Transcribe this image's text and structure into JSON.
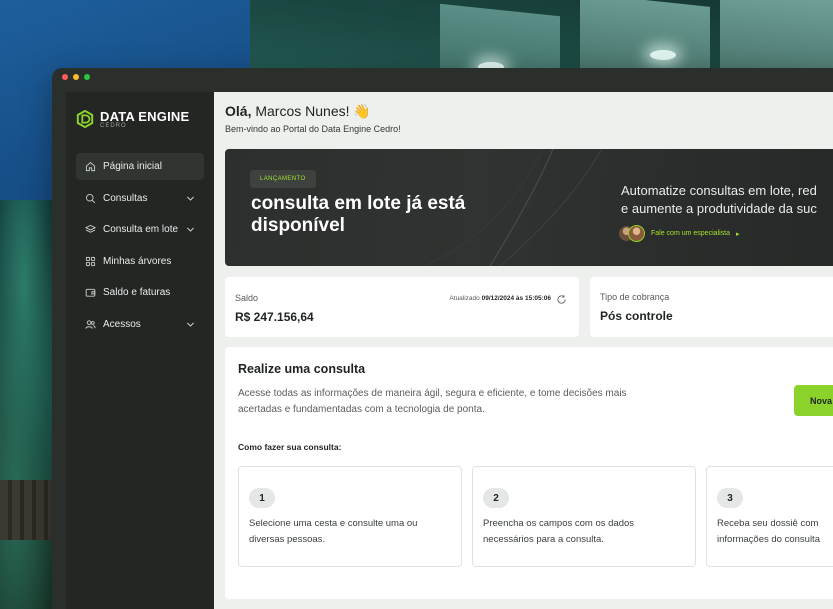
{
  "colors": {
    "accent": "#8bd32a",
    "accent_text": "#a6e22e",
    "sidebar": "#232623",
    "main_bg": "#eef0ee"
  },
  "window": {
    "dots": [
      "#ff5f57",
      "#febc2e",
      "#28c840"
    ]
  },
  "brand": {
    "name": "DATA ENGINE",
    "sub": "CEDRO",
    "logo_icon": "data-engine-logo-icon"
  },
  "sidebar": {
    "items": [
      {
        "label": "Página inicial",
        "icon": "home-icon",
        "active": true,
        "expandable": false
      },
      {
        "label": "Consultas",
        "icon": "search-icon",
        "active": false,
        "expandable": true
      },
      {
        "label": "Consulta em lote",
        "icon": "layers-icon",
        "active": false,
        "expandable": true
      },
      {
        "label": "Minhas árvores",
        "icon": "grid-icon",
        "active": false,
        "expandable": false
      },
      {
        "label": "Saldo e faturas",
        "icon": "wallet-icon",
        "active": false,
        "expandable": false
      },
      {
        "label": "Acessos",
        "icon": "users-icon",
        "active": false,
        "expandable": true
      }
    ]
  },
  "header": {
    "greeting_prefix": "Olá,",
    "user_name": "Marcos Nunes!",
    "wave": "👋",
    "subtitle": "Bem-vindo ao Portal do Data Engine Cedro!"
  },
  "banner": {
    "tag": "LANÇAMENTO",
    "title": "consulta em lote já está disponível",
    "text_line1": "Automatize consultas em lote, red",
    "text_line2": "e aumente a produtividade da suc",
    "cta": "Fale com um especialista",
    "cta_arrow": "▸"
  },
  "saldo": {
    "label": "Saldo",
    "value": "R$ 247.156,64",
    "updated_label": "Atualizado",
    "updated_value": "09/12/2024 às 15:05:06"
  },
  "billing": {
    "label": "Tipo de cobrança",
    "value": "Pós controle"
  },
  "consulta": {
    "title": "Realize uma consulta",
    "description": "Acesse todas as informações de maneira ágil, segura e eficiente, e tome decisões mais acertadas e fundamentadas com a tecnologia de ponta.",
    "button": "Nova",
    "how_title": "Como fazer sua consulta:",
    "steps": [
      {
        "num": "1",
        "line1": "Selecione uma cesta e consulte uma ou",
        "line2": "diversas pessoas."
      },
      {
        "num": "2",
        "line1": "Preencha os campos com os dados",
        "line2": "necessários para a consulta."
      },
      {
        "num": "3",
        "line1": "Receba seu dossiê com",
        "line2": "informações do consulta"
      }
    ]
  }
}
